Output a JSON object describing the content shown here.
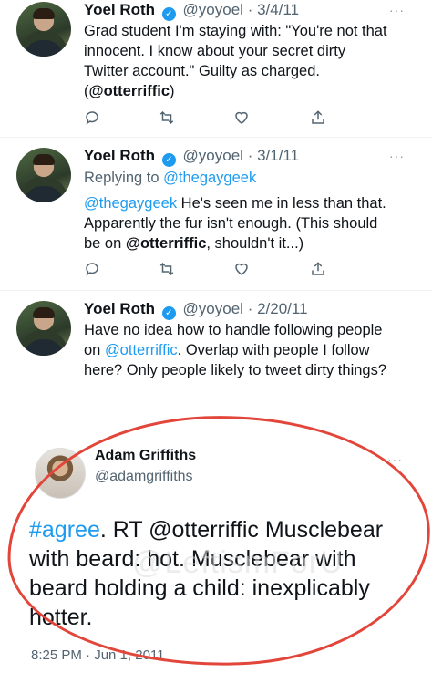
{
  "tweets": [
    {
      "name": "Yoel Roth",
      "handle": "@yoyoel",
      "date": "· 3/4/11",
      "reply_to": "",
      "text_pre": "Grad student I'm staying with: \"You're not that innocent. I know about your secret dirty Twitter account.\" Guilty as charged. (",
      "mention": "@otterriffic",
      "text_post": ")"
    },
    {
      "name": "Yoel Roth",
      "handle": "@yoyoel",
      "date": "· 3/1/11",
      "reply_prefix": "Replying to ",
      "reply_to": "@thegaygeek",
      "lead_mention": "@thegaygeek",
      "text_pre": " He's seen me in less than that. Apparently the fur isn't enough. (This should be on ",
      "mention": "@otterriffic",
      "text_post": ", shouldn't it...)"
    },
    {
      "name": "Yoel Roth",
      "handle": "@yoyoel",
      "date": "· 2/20/11",
      "text_pre": "Have no idea how to handle following people on ",
      "mention": "@otterriffic",
      "text_post": ". Overlap with people I follow here? Only people likely to tweet dirty things?"
    }
  ],
  "actions": {
    "reply_icon": "reply-icon",
    "retweet_icon": "retweet-icon",
    "like_icon": "like-icon",
    "share_icon": "share-icon"
  },
  "highlighted": {
    "name": "Adam Griffiths",
    "handle": "@adamgriffiths",
    "hashtag": "#agree",
    "text_rest": ". RT @otterriffic Musclebear with beard: hot. Musclebear with beard holding a child: inexplicably hotter.",
    "meta": "8:25 PM · Jun 1, 2011"
  },
  "watermark": "@LeftismForU",
  "colors": {
    "link": "#1d9bf0",
    "verified": "#1d9bf0",
    "highlight_circle": "#e2463b",
    "secondary_text": "#536471"
  }
}
